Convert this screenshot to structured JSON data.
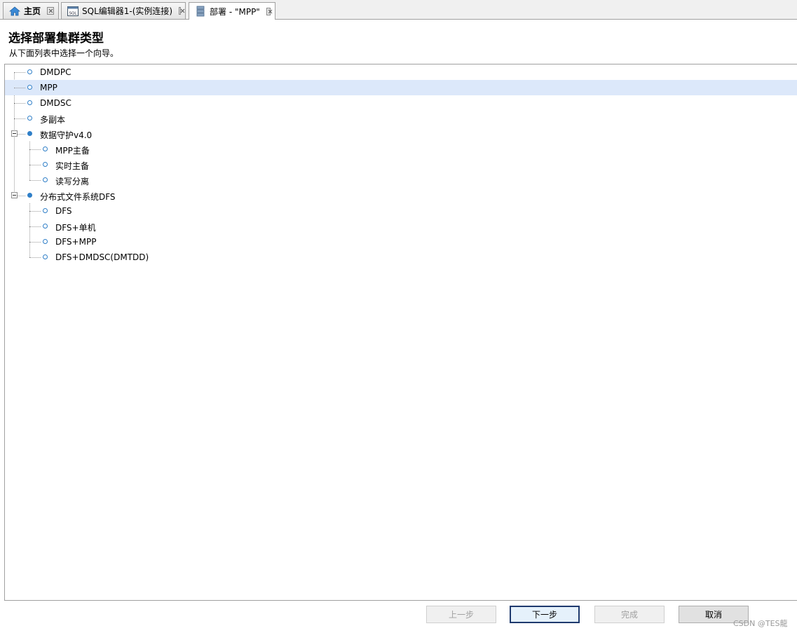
{
  "tabs": [
    {
      "label": "主页",
      "icon": "home-icon"
    },
    {
      "label": "SQL编辑器1-(实例连接)",
      "icon": "sql-icon"
    },
    {
      "label": "部署 - \"MPP\"",
      "icon": "deploy-icon"
    }
  ],
  "header": {
    "title": "选择部署集群类型",
    "subtitle": "从下面列表中选择一个向导。"
  },
  "tree": {
    "nodes": [
      {
        "label": "DMDPC"
      },
      {
        "label": "MPP",
        "selected": true
      },
      {
        "label": "DMDSC"
      },
      {
        "label": "多副本"
      },
      {
        "label": "数据守护v4.0",
        "expanded": true
      },
      {
        "label": "MPP主备"
      },
      {
        "label": "实时主备"
      },
      {
        "label": "读写分离"
      },
      {
        "label": "分布式文件系统DFS",
        "expanded": true
      },
      {
        "label": "DFS"
      },
      {
        "label": "DFS+单机"
      },
      {
        "label": "DFS+MPP"
      },
      {
        "label": "DFS+DMDSC(DMTDD)"
      }
    ]
  },
  "buttons": {
    "back": "上一步",
    "next": "下一步",
    "finish": "完成",
    "cancel": "取消"
  },
  "watermark": "CSDN @TES龍",
  "colors": {
    "accent": "#2f7fc8",
    "selection": "#dce8fa"
  }
}
